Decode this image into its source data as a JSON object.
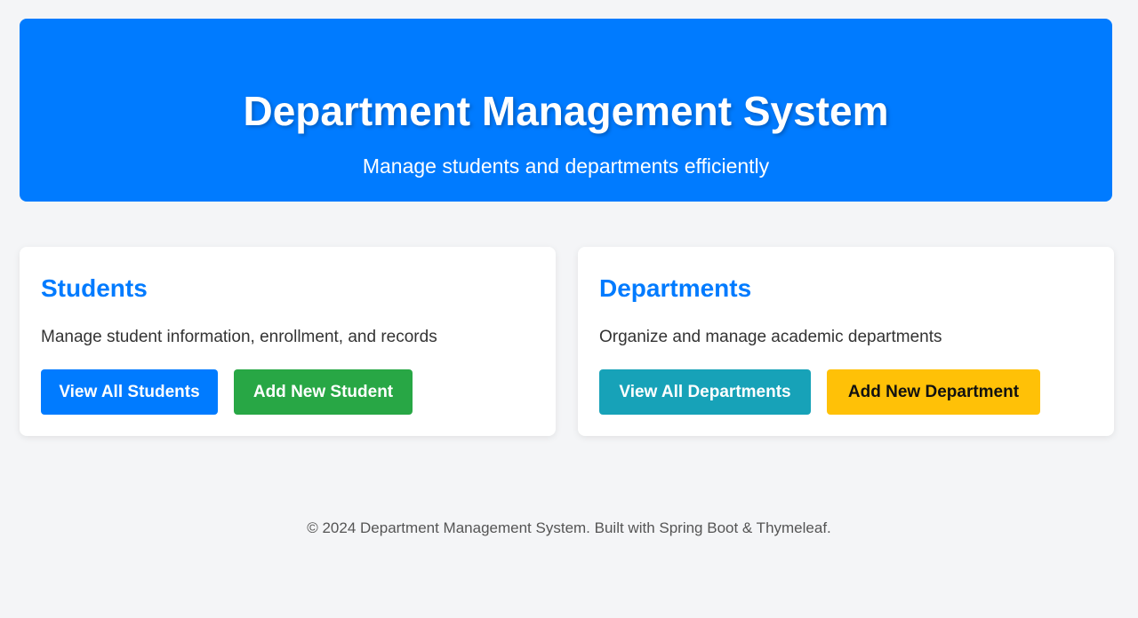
{
  "header": {
    "title": "Department Management System",
    "subtitle": "Manage students and departments efficiently"
  },
  "cards": {
    "students": {
      "title": "Students",
      "description": "Manage student information, enrollment, and records",
      "view_label": "View All Students",
      "add_label": "Add New Student"
    },
    "departments": {
      "title": "Departments",
      "description": "Organize and manage academic departments",
      "view_label": "View All Departments",
      "add_label": "Add New Department"
    }
  },
  "footer": {
    "text": "© 2024 Department Management System. Built with Spring Boot & Thymeleaf."
  },
  "colors": {
    "primary": "#007bff",
    "success": "#28a745",
    "info": "#17a2b8",
    "warning": "#ffc107",
    "background": "#f4f5f7"
  }
}
